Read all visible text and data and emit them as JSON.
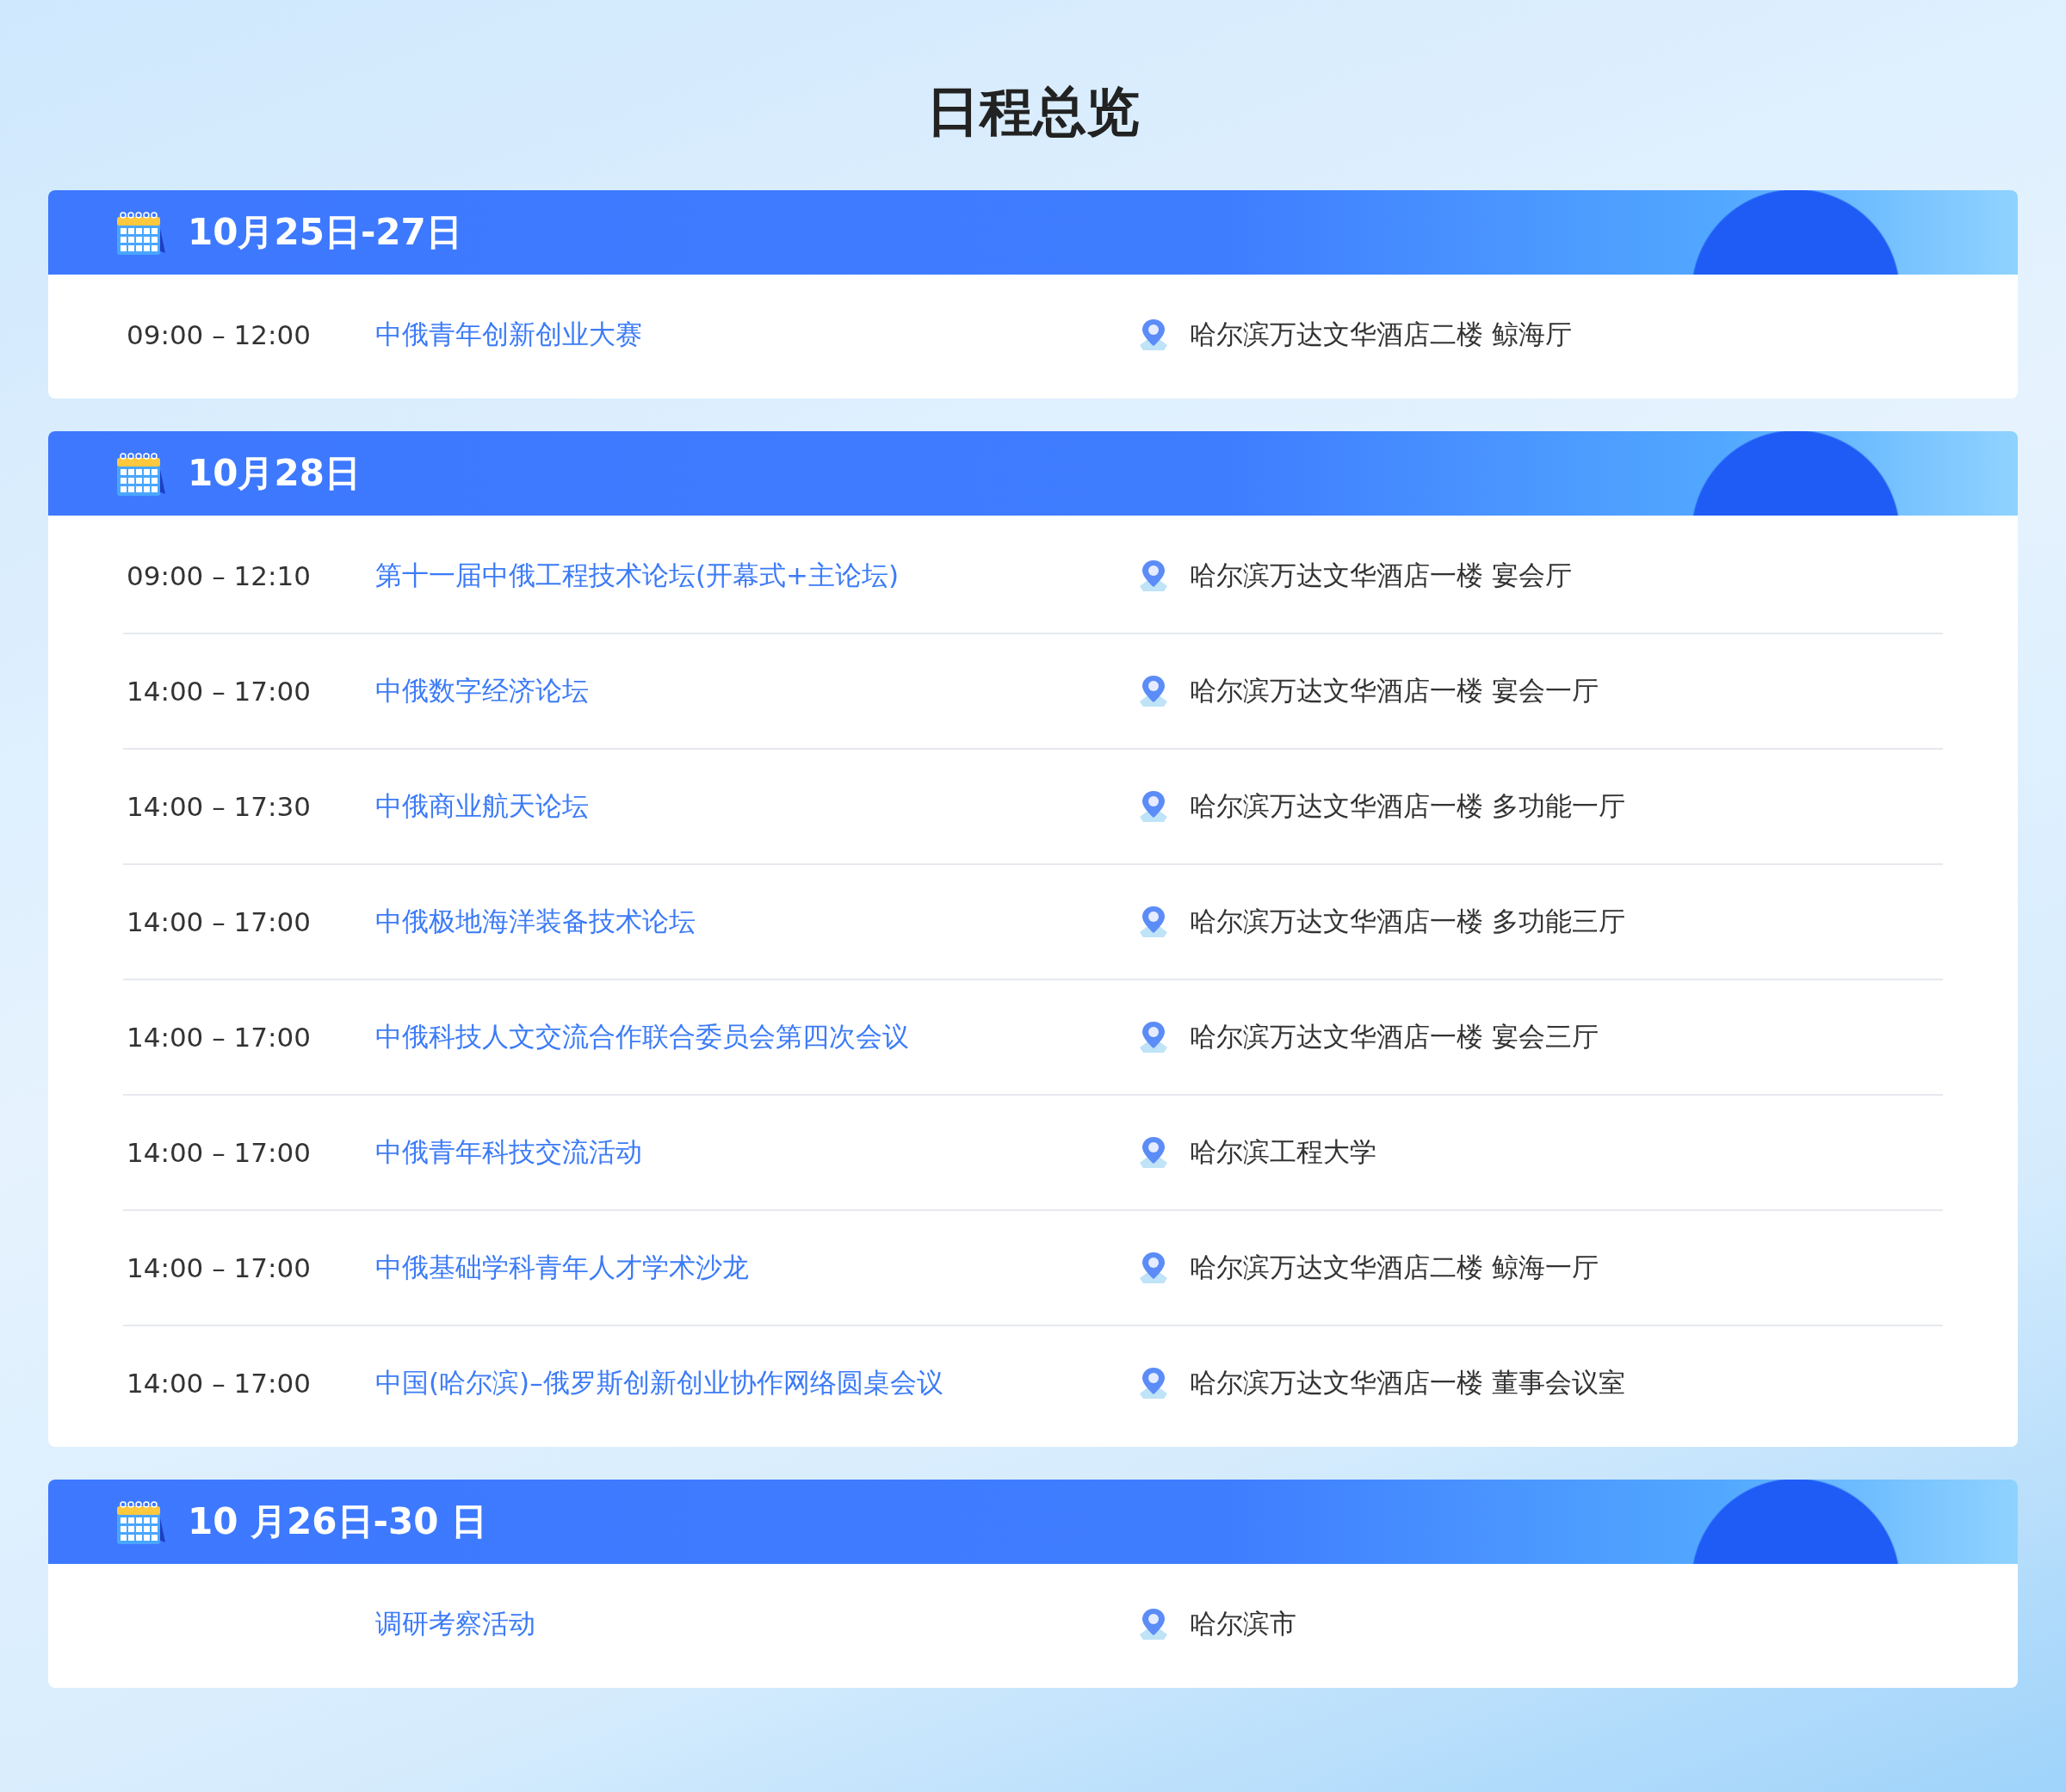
{
  "title": "日程总览",
  "days": [
    {
      "date": "10月25日-27日",
      "events": [
        {
          "time": "09:00 – 12:00",
          "name": "中俄青年创新创业大赛",
          "location": "哈尔滨万达文华酒店二楼 鲸海厅"
        }
      ]
    },
    {
      "date": "10月28日",
      "events": [
        {
          "time": "09:00 – 12:10",
          "name": "第十一届中俄工程技术论坛(开幕式+主论坛)",
          "location": "哈尔滨万达文华酒店一楼 宴会厅"
        },
        {
          "time": "14:00 – 17:00",
          "name": "中俄数字经济论坛",
          "location": "哈尔滨万达文华酒店一楼 宴会一厅"
        },
        {
          "time": "14:00 – 17:30",
          "name": "中俄商业航天论坛",
          "location": "哈尔滨万达文华酒店一楼 多功能一厅"
        },
        {
          "time": "14:00 – 17:00",
          "name": "中俄极地海洋装备技术论坛",
          "location": "哈尔滨万达文华酒店一楼 多功能三厅"
        },
        {
          "time": "14:00 – 17:00",
          "name": "中俄科技人文交流合作联合委员会第四次会议",
          "location": "哈尔滨万达文华酒店一楼 宴会三厅"
        },
        {
          "time": "14:00 – 17:00",
          "name": "中俄青年科技交流活动",
          "location": "哈尔滨工程大学"
        },
        {
          "time": "14:00 – 17:00",
          "name": "中俄基础学科青年人才学术沙龙",
          "location": "哈尔滨万达文华酒店二楼 鲸海一厅"
        },
        {
          "time": "14:00 – 17:00",
          "name": "中国(哈尔滨)–俄罗斯创新创业协作网络圆桌会议",
          "location": "哈尔滨万达文华酒店一楼 董事会议室"
        }
      ]
    },
    {
      "date": "10 月26日-30 日",
      "events": [
        {
          "name": "调研考察活动",
          "location": "哈尔滨市"
        }
      ]
    }
  ]
}
